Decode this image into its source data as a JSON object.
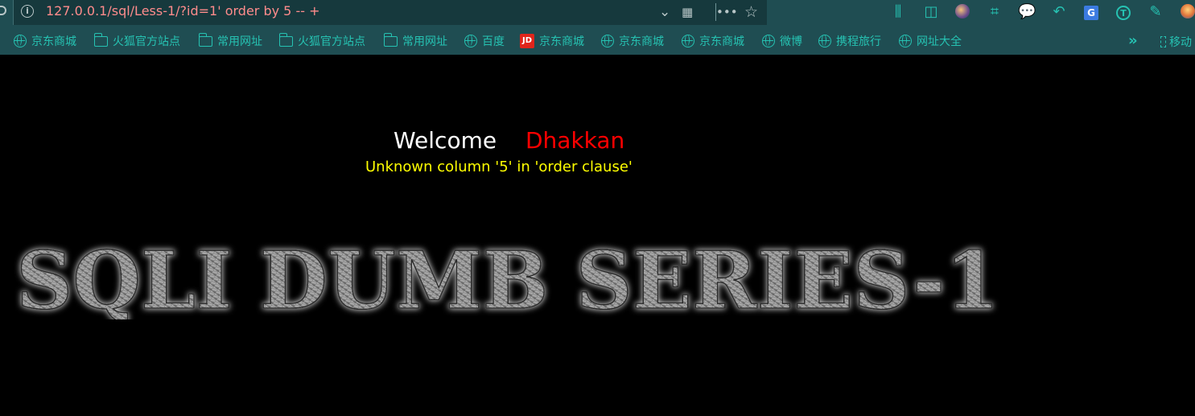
{
  "browser": {
    "url": "127.0.0.1/sql/Less-1/?id=1' order by 5 -- +",
    "toolbar_icons": [
      "library-icon",
      "sidebar-icon",
      "avatar-icon",
      "crop-icon",
      "chat-icon",
      "back-icon",
      "translate-icon",
      "t-icon",
      "edit-icon",
      "extension-icon"
    ],
    "url_icons": [
      "info-icon",
      "chevron-down-icon",
      "qr-code-icon",
      "more-icon",
      "star-icon"
    ]
  },
  "bookmarks": {
    "items": [
      {
        "label": "京东商城",
        "icon": "globe-icon"
      },
      {
        "label": "火狐官方站点",
        "icon": "folder-icon"
      },
      {
        "label": "常用网址",
        "icon": "folder-icon"
      },
      {
        "label": "火狐官方站点",
        "icon": "folder-icon"
      },
      {
        "label": "常用网址",
        "icon": "folder-icon"
      },
      {
        "label": "百度",
        "icon": "globe-icon"
      },
      {
        "label": "京东商城",
        "icon": "jd-icon"
      },
      {
        "label": "京东商城",
        "icon": "globe-icon"
      },
      {
        "label": "京东商城",
        "icon": "globe-icon"
      },
      {
        "label": "微博",
        "icon": "globe-icon"
      },
      {
        "label": "携程旅行",
        "icon": "globe-icon"
      },
      {
        "label": "网址大全",
        "icon": "globe-icon"
      }
    ],
    "more": "»",
    "mobile": "移动"
  },
  "page": {
    "welcome": "Welcome",
    "username": "Dhakkan",
    "error": "Unknown column '5' in 'order clause'",
    "banner": "SQLI DUMB SERIES-1"
  },
  "colors": {
    "toolbar_bg": "#1f4d52",
    "accent": "#26c2b2",
    "url_text": "#ff8c8c",
    "welcome": "#ffffff",
    "username": "#ff0000",
    "error": "#ffff00"
  }
}
